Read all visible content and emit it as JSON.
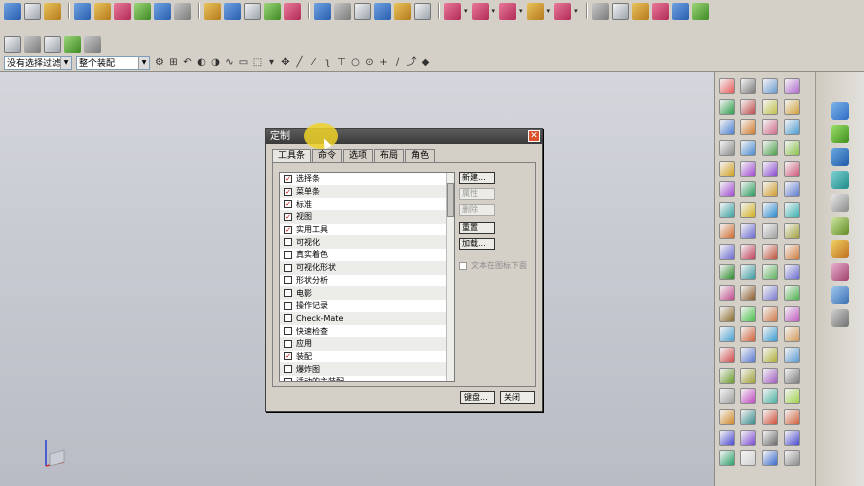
{
  "toolbar": {
    "selection_filter": "没有选择过滤器",
    "assembly_scope": "整个装配"
  },
  "dialog": {
    "title": "定制",
    "close_glyph": "✕",
    "tabs": [
      {
        "label": "工具条",
        "active": true
      },
      {
        "label": "命令",
        "active": false
      },
      {
        "label": "选项",
        "active": false
      },
      {
        "label": "布局",
        "active": false
      },
      {
        "label": "角色",
        "active": false
      }
    ],
    "list_items": [
      {
        "label": "选择条",
        "checked": true
      },
      {
        "label": "菜单条",
        "checked": true
      },
      {
        "label": "标准",
        "checked": true
      },
      {
        "label": "视图",
        "checked": true
      },
      {
        "label": "实用工具",
        "checked": true
      },
      {
        "label": "可视化",
        "checked": false
      },
      {
        "label": "真实着色",
        "checked": false
      },
      {
        "label": "可视化形状",
        "checked": false
      },
      {
        "label": "形状分析",
        "checked": false
      },
      {
        "label": "电影",
        "checked": false
      },
      {
        "label": "操作记录",
        "checked": false
      },
      {
        "label": "Check-Mate",
        "checked": false
      },
      {
        "label": "快速检查",
        "checked": false
      },
      {
        "label": "应用",
        "checked": false
      },
      {
        "label": "装配",
        "checked": true
      },
      {
        "label": "爆炸图",
        "checked": false
      },
      {
        "label": "活动的主装配",
        "checked": false
      }
    ],
    "buttons": {
      "new": "新建...",
      "properties": "属性",
      "delete": "删除",
      "reset": "重置",
      "load": "加载..."
    },
    "text_below_icon": "文本在图标下面",
    "keyboard": "键盘...",
    "close": "关闭"
  }
}
